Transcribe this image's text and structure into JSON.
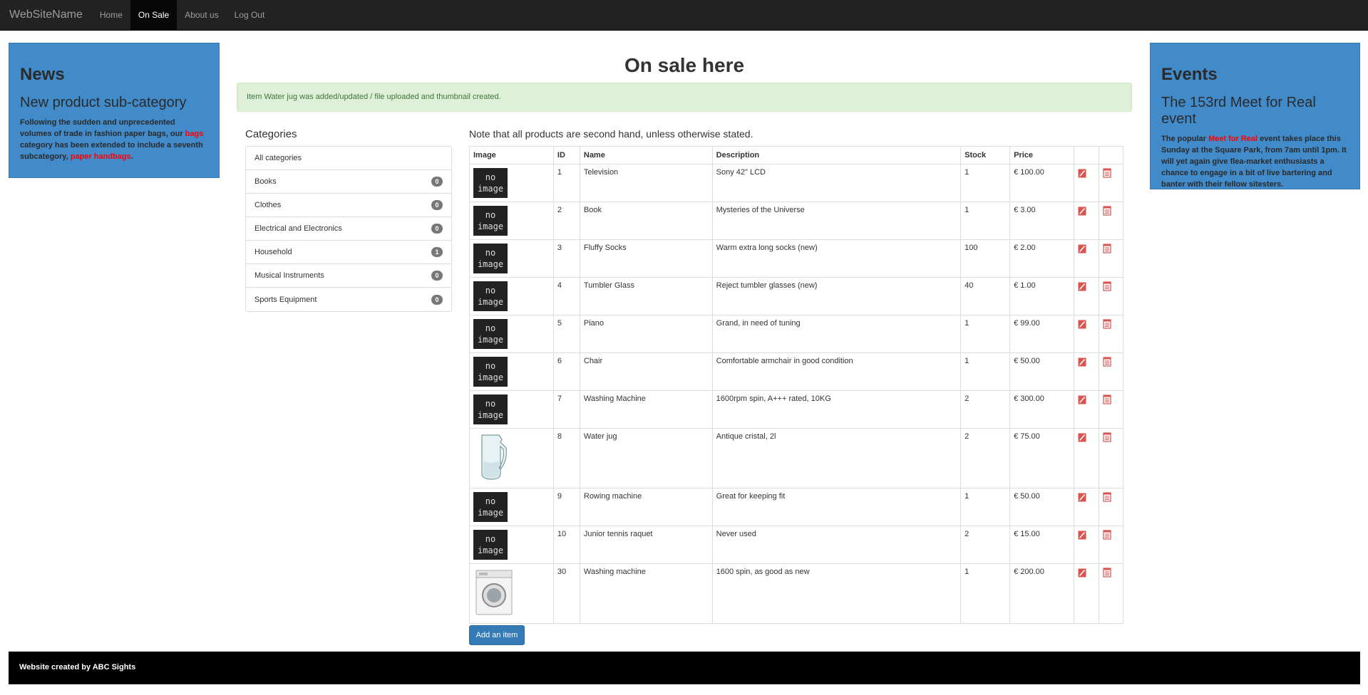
{
  "nav": {
    "brand": "WebSiteName",
    "items": [
      {
        "label": "Home",
        "active": false
      },
      {
        "label": "On Sale",
        "active": true
      },
      {
        "label": "About us",
        "active": false
      },
      {
        "label": "Log Out",
        "active": false
      }
    ]
  },
  "news": {
    "title": "News",
    "subtitle": "New product sub-category",
    "text_1": "Following the sudden and unprecedented volumes of trade in fashion paper bags, our ",
    "link_1": "bags",
    "text_2": " category has been extended to include a seventh subcategory, ",
    "link_2": "paper handbags",
    "text_3": "."
  },
  "events": {
    "title": "Events",
    "subtitle": "The 153rd Meet for Real event",
    "text_1": "The popular ",
    "link_1": "Meet for Real",
    "text_2": " event takes place this Sunday at the Square Park, from 7am until 1pm. It will yet again give flea-market enthusiasts a chance to engage in a bit of live bartering and banter with their fellow sitesters."
  },
  "main": {
    "title": "On sale here",
    "alert": "Item Water jug was added/updated / file uploaded and thumbnail created.",
    "note": "Note that all products are second hand, unless otherwise stated.",
    "add_button": "Add an item"
  },
  "categories": {
    "heading": "Categories",
    "items": [
      {
        "label": "All categories",
        "count": ""
      },
      {
        "label": "Books",
        "count": "0"
      },
      {
        "label": "Clothes",
        "count": "0"
      },
      {
        "label": "Electrical and Electronics",
        "count": "0"
      },
      {
        "label": "Household",
        "count": "1"
      },
      {
        "label": "Musical Instruments",
        "count": "0"
      },
      {
        "label": "Sports Equipment",
        "count": "0"
      }
    ]
  },
  "table": {
    "headers": [
      "Image",
      "ID",
      "Name",
      "Description",
      "Stock",
      "Price",
      "",
      ""
    ],
    "no_image_line1": "no",
    "no_image_line2": "image",
    "rows": [
      {
        "image": "no-image",
        "id": "1",
        "name": "Television",
        "description": "Sony 42\" LCD",
        "stock": "1",
        "price": "€ 100.00"
      },
      {
        "image": "no-image",
        "id": "2",
        "name": "Book",
        "description": "Mysteries of the Universe",
        "stock": "1",
        "price": "€ 3.00"
      },
      {
        "image": "no-image",
        "id": "3",
        "name": "Fluffy Socks",
        "description": "Warm extra long socks (new)",
        "stock": "100",
        "price": "€ 2.00"
      },
      {
        "image": "no-image",
        "id": "4",
        "name": "Tumbler Glass",
        "description": "Reject tumbler glasses (new)",
        "stock": "40",
        "price": "€ 1.00"
      },
      {
        "image": "no-image",
        "id": "5",
        "name": "Piano",
        "description": "Grand, in need of tuning",
        "stock": "1",
        "price": "€ 99.00"
      },
      {
        "image": "no-image",
        "id": "6",
        "name": "Chair",
        "description": "Comfortable armchair in good condition",
        "stock": "1",
        "price": "€ 50.00"
      },
      {
        "image": "no-image",
        "id": "7",
        "name": "Washing Machine",
        "description": "1600rpm spin, A+++ rated, 10KG",
        "stock": "2",
        "price": "€ 300.00"
      },
      {
        "image": "jug-photo",
        "id": "8",
        "name": "Water jug",
        "description": "Antique cristal, 2l",
        "stock": "2",
        "price": "€ 75.00"
      },
      {
        "image": "no-image",
        "id": "9",
        "name": "Rowing machine",
        "description": "Great for keeping fit",
        "stock": "1",
        "price": "€ 50.00"
      },
      {
        "image": "no-image",
        "id": "10",
        "name": "Junior tennis raquet",
        "description": "Never used",
        "stock": "2",
        "price": "€ 15.00"
      },
      {
        "image": "washer-photo",
        "id": "30",
        "name": "Washing machine",
        "description": "1600 spin, as good as new",
        "stock": "1",
        "price": "€ 200.00"
      }
    ]
  },
  "footer": {
    "text": "Website created by ABC Sights"
  },
  "colors": {
    "navbar": "#222222",
    "panel_blue": "#428bca",
    "alert_bg": "#dff0d8",
    "button": "#337ab7",
    "icon_red": "#d9534f"
  }
}
